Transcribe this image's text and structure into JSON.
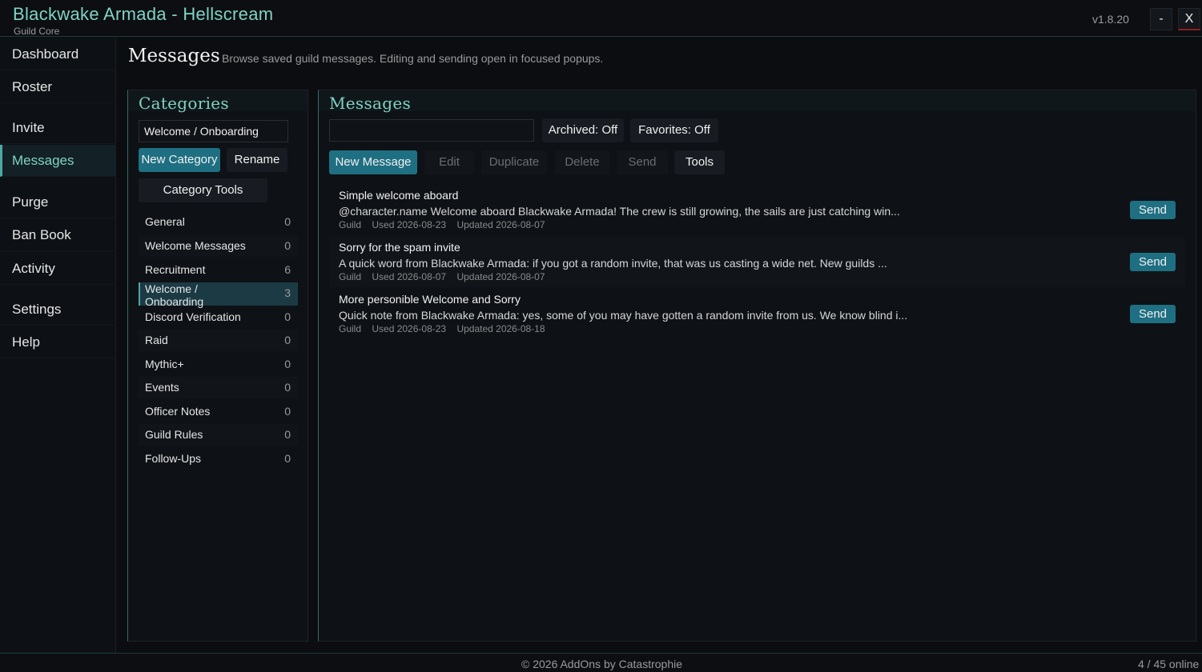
{
  "window": {
    "title": "Blackwake Armada - Hellscream",
    "subtitle": "Guild Core",
    "version": "v1.8.20",
    "minimize_label": "-",
    "close_label": "X"
  },
  "sidebar": {
    "items": [
      {
        "label": "Dashboard"
      },
      {
        "label": "Roster"
      },
      {
        "label": "Invite"
      },
      {
        "label": "Messages"
      },
      {
        "label": "Purge"
      },
      {
        "label": "Ban Book"
      },
      {
        "label": "Activity"
      },
      {
        "label": "Settings"
      },
      {
        "label": "Help"
      }
    ],
    "active": "Messages"
  },
  "page": {
    "title": "Messages",
    "description": "Browse saved guild messages. Editing and sending open in focused popups."
  },
  "categories": {
    "title": "Categories",
    "name_input_value": "Welcome / Onboarding",
    "new_label": "New Category",
    "rename_label": "Rename",
    "tools_label": "Category Tools",
    "list": [
      {
        "name": "General",
        "count": "0"
      },
      {
        "name": "Welcome Messages",
        "count": "0"
      },
      {
        "name": "Recruitment",
        "count": "6"
      },
      {
        "name": "Welcome / Onboarding",
        "count": "3"
      },
      {
        "name": "Discord Verification",
        "count": "0"
      },
      {
        "name": "Raid",
        "count": "0"
      },
      {
        "name": "Mythic+",
        "count": "0"
      },
      {
        "name": "Events",
        "count": "0"
      },
      {
        "name": "Officer Notes",
        "count": "0"
      },
      {
        "name": "Guild Rules",
        "count": "0"
      },
      {
        "name": "Follow-Ups",
        "count": "0"
      }
    ]
  },
  "messages": {
    "title": "Messages",
    "search_value": "",
    "archived_label": "Archived: Off",
    "favorites_label": "Favorites: Off",
    "toolbar": {
      "new_label": "New Message",
      "edit_label": "Edit",
      "duplicate_label": "Duplicate",
      "delete_label": "Delete",
      "send_label": "Send",
      "tools_label": "Tools"
    },
    "list": [
      {
        "title": "Simple welcome aboard",
        "body": "@character.name Welcome aboard Blackwake Armada! The crew is still growing, the sails are just catching win...",
        "channel": "Guild",
        "used": "Used 2026-08-23",
        "updated": "Updated 2026-08-07",
        "send_label": "Send"
      },
      {
        "title": "Sorry for the spam invite",
        "body": "A quick word from Blackwake Armada: if you got a random invite, that was us casting a wide net. New guilds ...",
        "channel": "Guild",
        "used": "Used 2026-08-07",
        "updated": "Updated 2026-08-07",
        "send_label": "Send"
      },
      {
        "title": "More personible Welcome and Sorry",
        "body": "Quick note from Blackwake Armada: yes, some of you may have gotten a random invite from us. We know blind i...",
        "channel": "Guild",
        "used": "Used 2026-08-23",
        "updated": "Updated 2026-08-18",
        "send_label": "Send"
      }
    ]
  },
  "footer": {
    "copyright": "© 2026 AddOns by Catastrophie",
    "online": "4 / 45 online"
  }
}
